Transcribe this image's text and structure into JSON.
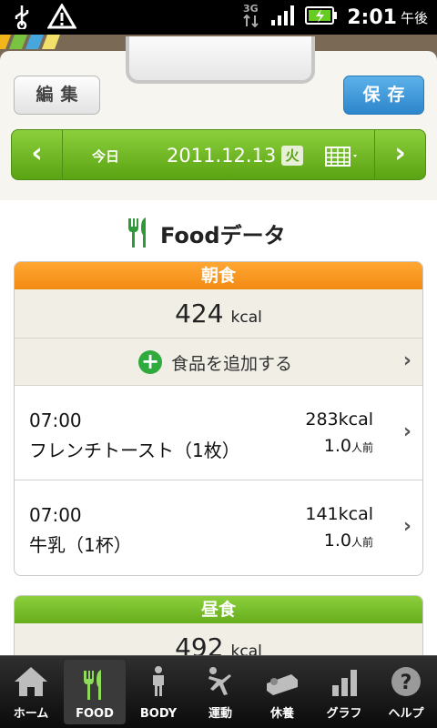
{
  "status_bar": {
    "time": "2:01",
    "ampm": "午後",
    "network": "3G"
  },
  "header": {
    "edit_label": "編集",
    "save_label": "保存"
  },
  "date_nav": {
    "prev_icon": "chevron-left-icon",
    "today_label": "今日",
    "date": "2011.12.13",
    "weekday": "火",
    "calendar_icon": "calendar-icon",
    "next_icon": "chevron-right-icon"
  },
  "page": {
    "title": "Foodデータ",
    "title_icon": "fork-knife-icon"
  },
  "breakfast": {
    "title": "朝食",
    "total_kcal": "424",
    "kcal_unit": "kcal",
    "add_label": "食品を追加する",
    "entries": [
      {
        "time": "07:00",
        "name": "フレンチトースト（1枚）",
        "kcal": "283kcal",
        "portion": "1.0",
        "portion_unit": "人前"
      },
      {
        "time": "07:00",
        "name": "牛乳（1杯）",
        "kcal": "141kcal",
        "portion": "1.0",
        "portion_unit": "人前"
      }
    ]
  },
  "lunch": {
    "title": "昼食",
    "total_kcal": "492",
    "kcal_unit": "kcal"
  },
  "tabs": [
    {
      "label": "ホーム",
      "icon": "home-icon",
      "active": false
    },
    {
      "label": "FOOD",
      "icon": "fork-knife-icon",
      "active": true
    },
    {
      "label": "BODY",
      "icon": "body-icon",
      "active": false
    },
    {
      "label": "運動",
      "icon": "exercise-icon",
      "active": false
    },
    {
      "label": "休養",
      "icon": "rest-icon",
      "active": false
    },
    {
      "label": "グラフ",
      "icon": "graph-icon",
      "active": false
    },
    {
      "label": "ヘルプ",
      "icon": "help-icon",
      "active": false
    }
  ],
  "colors": {
    "accent_green": "#6ab31e",
    "breakfast_orange": "#f6951d",
    "save_blue": "#3a93d6"
  }
}
